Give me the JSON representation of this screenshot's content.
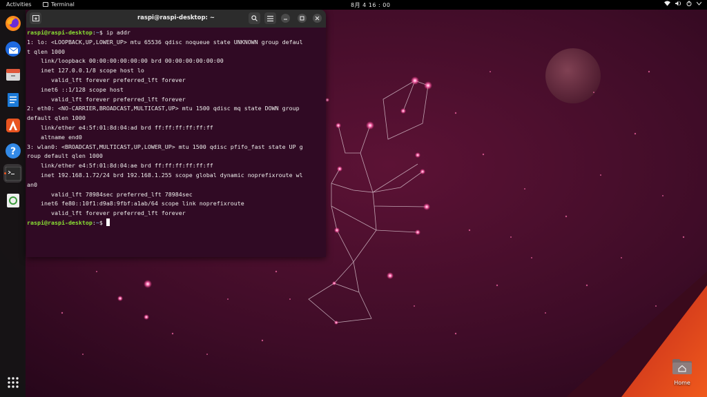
{
  "topbar": {
    "activities_label": "Activities",
    "app_name": "Terminal",
    "clock": "8月 4  16 : 00",
    "tray_icons": [
      "wifi-icon",
      "volume-icon",
      "power-icon",
      "chevron-down-icon"
    ]
  },
  "dock": {
    "items": [
      "firefox",
      "thunderbird",
      "files",
      "libreoffice-writer",
      "ubuntu-software",
      "help",
      "terminal",
      "trash"
    ],
    "show_apps_label": "Show Applications"
  },
  "terminal": {
    "title": "raspi@raspi-desktop: ~",
    "prompt_user": "raspi@raspi-desktop",
    "prompt_path": "~",
    "prompt_symbol": "$",
    "command": "ip addr",
    "output": [
      "1: lo: <LOOPBACK,UP,LOWER_UP> mtu 65536 qdisc noqueue state UNKNOWN group defaul",
      "t qlen 1000",
      "    link/loopback 00:00:00:00:00:00 brd 00:00:00:00:00:00",
      "    inet 127.0.0.1/8 scope host lo",
      "       valid_lft forever preferred_lft forever",
      "    inet6 ::1/128 scope host",
      "       valid_lft forever preferred_lft forever",
      "2: eth0: <NO-CARRIER,BROADCAST,MULTICAST,UP> mtu 1500 qdisc mq state DOWN group",
      "default qlen 1000",
      "    link/ether e4:5f:01:8d:04:ad brd ff:ff:ff:ff:ff:ff",
      "    altname end0",
      "3: wlan0: <BROADCAST,MULTICAST,UP,LOWER_UP> mtu 1500 qdisc pfifo_fast state UP g",
      "roup default qlen 1000",
      "    link/ether e4:5f:01:8d:04:ae brd ff:ff:ff:ff:ff:ff",
      "    inet 192.168.1.72/24 brd 192.168.1.255 scope global dynamic noprefixroute wl",
      "an0",
      "       valid_lft 78984sec preferred_lft 78984sec",
      "    inet6 fe80::10f1:d9a8:9fbf:a1ab/64 scope link noprefixroute",
      "       valid_lft forever preferred_lft forever"
    ]
  },
  "desktop": {
    "home_label": "Home"
  },
  "colors": {
    "terminal_bg": "#300a24",
    "prompt_user": "#8ae234",
    "prompt_path": "#729fcf",
    "accent": "#e95420"
  }
}
